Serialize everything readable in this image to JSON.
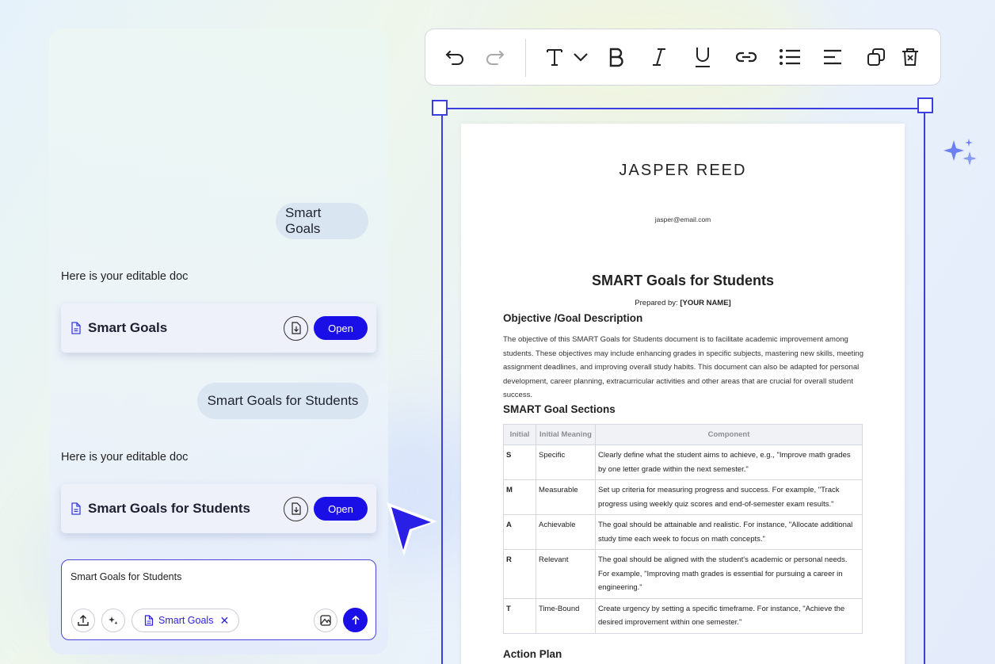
{
  "chat": {
    "messages": [
      {
        "role": "user",
        "text": "Smart Goals"
      },
      {
        "role": "assistant",
        "text": "Here is your editable doc",
        "card": {
          "title": "Smart Goals",
          "open_label": "Open"
        }
      },
      {
        "role": "user",
        "text": "Smart Goals for Students"
      },
      {
        "role": "assistant",
        "text": "Here is your editable doc",
        "card": {
          "title": "Smart Goals for Students",
          "open_label": "Open"
        }
      }
    ],
    "composer": {
      "value": "Smart Goals for Students",
      "attachment_chip": "Smart Goals",
      "chip_remove_glyph": "✕"
    }
  },
  "toolbar": {
    "icons": [
      "undo-icon",
      "redo-icon",
      "text-style-icon",
      "chevron-down-icon",
      "bold-icon",
      "italic-icon",
      "underline-icon",
      "link-icon",
      "bullet-list-icon",
      "align-left-icon",
      "duplicate-icon",
      "delete-icon"
    ]
  },
  "document": {
    "name": "JASPER REED",
    "email": "jasper@email.com",
    "title": "SMART Goals for Students",
    "prepared_label": "Prepared by:",
    "prepared_value": "[YOUR NAME]",
    "objective_heading": "Objective /Goal Description",
    "objective_text": "The objective of this SMART Goals for Students document is to facilitate academic improvement among students. These objectives may include enhancing grades in specific subjects, mastering new skills, meeting assignment deadlines, and improving overall study habits. This document can also be adapted for personal development, career planning, extracurricular activities and other areas that are crucial for overall student success.",
    "sections_heading": "SMART Goal Sections",
    "table": {
      "headers": [
        "Initial",
        "Initial Meaning",
        "Component"
      ],
      "rows": [
        [
          "S",
          "Specific",
          "Clearly define what the student aims to achieve, e.g., \"Improve math grades by one letter grade within the next semester.\""
        ],
        [
          "M",
          "Measurable",
          "Set up criteria for measuring progress and success. For example, \"Track progress using weekly quiz scores and end-of-semester exam results.\""
        ],
        [
          "A",
          "Achievable",
          "The goal should be attainable and realistic. For instance, \"Allocate additional study time each week to focus on math concepts.\""
        ],
        [
          "R",
          "Relevant",
          "The goal should be aligned with the student's academic or personal needs. For example, \"Improving math grades is essential for pursuing a career in engineering.\""
        ],
        [
          "T",
          "Time-Bound",
          "Create urgency by setting a specific timeframe. For instance, \"Achieve the desired improvement within one semester.\""
        ]
      ]
    },
    "action_heading": "Action Plan"
  },
  "colors": {
    "primary": "#1a0fe6",
    "selection": "#3b3fe0",
    "bubble": "#d9e6f1",
    "card": "#eef1fa"
  }
}
